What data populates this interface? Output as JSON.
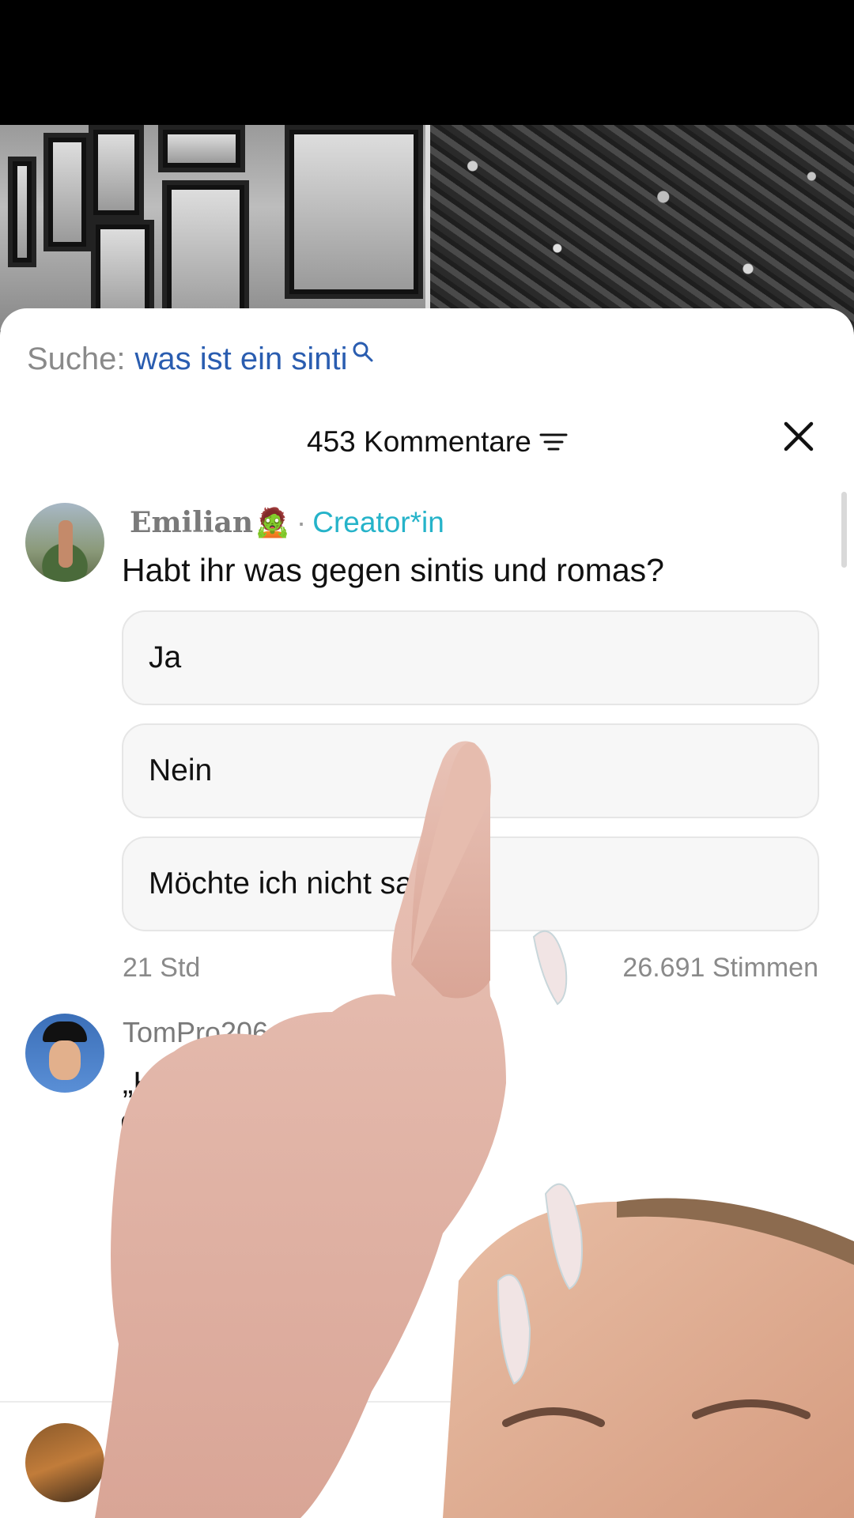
{
  "search": {
    "label": "Suche:",
    "query": "was ist ein sinti"
  },
  "comments_header": {
    "count_label": "453 Kommentare"
  },
  "poll_comment": {
    "author": "Emilian",
    "author_emoji": "🧟",
    "separator": "·",
    "badge": "Creator*in",
    "question": "Habt ihr was gegen sintis und romas?",
    "options": [
      {
        "label": "Ja"
      },
      {
        "label": "Nein"
      },
      {
        "label": "Möchte ich nicht sagen"
      }
    ],
    "age": "21 Std",
    "votes": "26.691 Stimmen"
  },
  "second_comment": {
    "author": "TomPro206",
    "text": "„H"
  },
  "colors": {
    "accent_search": "#2a5db0",
    "creator_badge": "#25b3c9",
    "sheet_bg": "#ffffff"
  },
  "icons": [
    "search-icon",
    "filter-icon",
    "close-icon",
    "image-icon",
    "emoji-icon",
    "mention-icon"
  ]
}
